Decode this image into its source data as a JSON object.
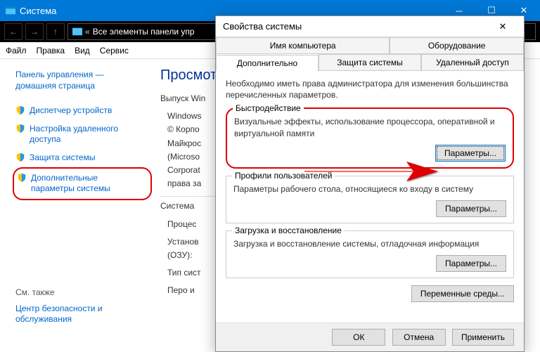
{
  "sys": {
    "title": "Система",
    "breadcrumb": "Все элементы панели упр"
  },
  "menu": {
    "file": "Файл",
    "edit": "Правка",
    "view": "Вид",
    "tools": "Сервис"
  },
  "side": {
    "home1": "Панель управления —",
    "home2": "домашняя страница",
    "devmgr": "Диспетчер устройств",
    "remote": "Настройка удаленного доступа",
    "protect": "Защита системы",
    "advanced": "Дополнительные параметры системы",
    "seealso": "См. также",
    "security": "Центр безопасности и обслуживания"
  },
  "main": {
    "head": "Просмот",
    "l1": "Выпуск Win",
    "l2": "Windows",
    "l3": "© Корпо",
    "l4": "Майкрос",
    "l5": "(Microso",
    "l6": "Corporat",
    "l7": "права за",
    "sec2": "Система",
    "l8": "Процес",
    "l9": "Установ",
    "l10": "(ОЗУ):",
    "l11": "Тип сист",
    "l12": "Перо и"
  },
  "dlg": {
    "title": "Свойства системы",
    "tab_computer": "Имя компьютера",
    "tab_hardware": "Оборудование",
    "tab_advanced": "Дополнительно",
    "tab_protection": "Защита системы",
    "tab_remote": "Удаленный доступ",
    "admin_note": "Необходимо иметь права администратора для изменения большинства перечисленных параметров.",
    "g1_title": "Быстродействие",
    "g1_desc": "Визуальные эффекты, использование процессора, оперативной и виртуальной памяти",
    "g2_title": "Профили пользователей",
    "g2_desc": "Параметры рабочего стола, относящиеся ко входу в систему",
    "g3_title": "Загрузка и восстановление",
    "g3_desc": "Загрузка и восстановление системы, отладочная информация",
    "params": "Параметры...",
    "env": "Переменные среды...",
    "ok": "ОК",
    "cancel": "Отмена",
    "apply": "Применить"
  }
}
